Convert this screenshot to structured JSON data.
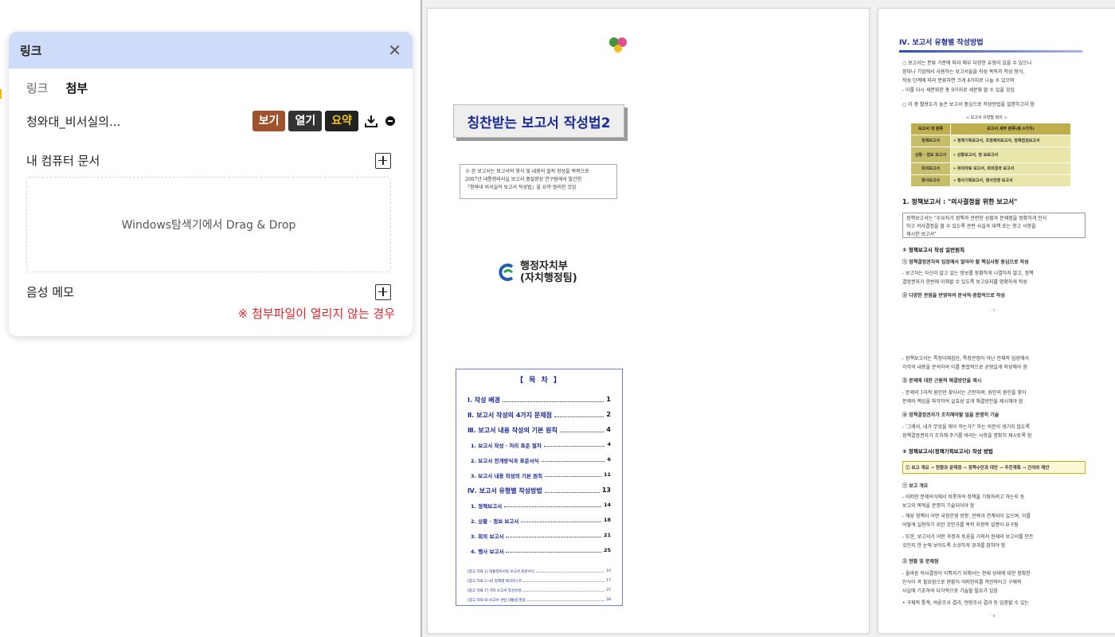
{
  "panel": {
    "title": "링크",
    "close_glyph": "✕",
    "tabs": [
      {
        "label": "링크",
        "active": false
      },
      {
        "label": "첨부",
        "active": true
      }
    ],
    "attachment": {
      "name": "청와대_비서실의...",
      "view_label": "보기",
      "open_label": "열기",
      "summary_label": "요약"
    },
    "my_docs_label": "내 컴퓨터 문서",
    "dropzone_text": "Windows탐색기에서 Drag & Drop",
    "voice_memo_label": "음성 메모",
    "warning_text": "※ 첨부파일이 열리지 않는 경우"
  },
  "document": {
    "page1": {
      "title": "칭찬받는 보고서 작성법2",
      "note_lines": [
        "※ 본 보고서는 보고서의 형식 및 내용의 질적 향상을 목적으로",
        "2007년 대통령비서실 보고서 품질향상 연구팀에서 발간한",
        "「청와대 비서실의 보고서 작성법」을 요약·정리한 것임"
      ],
      "ministry_line1": "행정자치부",
      "ministry_line2": "(자치행정팀)",
      "toc_title": "【 목  차 】",
      "toc": [
        {
          "label": "Ⅰ. 작성 배경",
          "page": "1",
          "level": 1
        },
        {
          "label": "Ⅱ. 보고서 작성의 4가지 문제점",
          "page": "2",
          "level": 1
        },
        {
          "label": "Ⅲ. 보고서 내용 작성의 기본 원칙",
          "page": "4",
          "level": 1
        },
        {
          "label": "1. 보고서 작성 · 처리 표준 절차",
          "page": "4",
          "level": 2
        },
        {
          "label": "2. 보고서 전개방식과 표준서식",
          "page": "6",
          "level": 2
        },
        {
          "label": "3. 보고서 내용 작성의 기본 원칙",
          "page": "11",
          "level": 2
        },
        {
          "label": "Ⅳ. 보고서 유형별 작성방법",
          "page": "13",
          "level": 1
        },
        {
          "label": "1. 정책보고서",
          "page": "14",
          "level": 2
        },
        {
          "label": "2. 상황 · 정보 보고서",
          "page": "18",
          "level": 2
        },
        {
          "label": "3. 회의 보고서",
          "page": "21",
          "level": 2
        },
        {
          "label": "4. 행사 보고서",
          "page": "25",
          "level": 2
        }
      ],
      "toc_refs": [
        {
          "label": "[참고 자료 1] 대통령비서실 보고서 표준서식",
          "page": "10"
        },
        {
          "label": "[참고 자료 2~6] 정책별 체크리스트",
          "page": "17"
        },
        {
          "label": "[참고 자료 7] 기타 보고서 작성유형",
          "page": "27"
        },
        {
          "label": "[참고 자료 8] 보고서 관련 대통령 말씀",
          "page": "28"
        }
      ]
    },
    "page2": {
      "heading": "Ⅳ. 보고서 유형별 작성방법",
      "intro_lines": [
        "○ 보고서는 분류 기준에 따라 매우 다양한 유형이 있을 수 있으나",
        "정부나 기업에서 사용하는 보고서들을 작성 목적과 작성 형식,",
        "작성 단계에 따라 분류하면 크게 4가지로 나눌 수 있으며",
        "- 이를 다시 세분화한 총 9가지로 세분화 할 수 있을 것임",
        "○ 이 중 활용도가 높은 보고서 중심으로 작성방법을 설명하고자 함"
      ],
      "table_title": "< 보고서 유형별 정의 >",
      "table_head": [
        "보고서 대 분류",
        "보고서 세부 분류(총 9가지)"
      ],
      "table_rows": [
        [
          "정책보고서",
          "• 정책기획보고서, 조정제의보고서, 정책점검보고서"
        ],
        [
          "상황 · 정보 보고서",
          "• 상황보고서, 정 보보고서"
        ],
        [
          "회의보고서",
          "• 회의자료 보고서, 회의결과 보고서"
        ],
        [
          "행사보고서",
          "• 행사기획보고서, 행사진행 보고서"
        ]
      ],
      "section1": "1. 정책보고서 : \"의사결정을 위한 보고서\"",
      "quote_lines": [
        "정책보고서는 \"수요자가 정책과 관련한 상황과 문제점을 정확하게 인식",
        "하고 의사결정을 할 수 있도록 관련 사실과 대책 또는 향고 사항을",
        "제시한 보고서\""
      ],
      "sub1": "① 정책보고서 작성 일반원칙",
      "p1_lines": [
        "① 정책결정권자의 입장에서 알아야 할 핵심사항 중심으로 작성",
        "- 보고자는 자신이 알고 있는 정보를 장황하게 나열하지 말고, 정책",
        "결정권자가 한번에 이해할 수 있도록 보고요지를 명확하게 작성",
        "② 다양한 관점을 반영하여 분석적·종합적으로 작성"
      ],
      "page_num_a": "- 3 -",
      "p2_lines": [
        "- 정책보고서는 특정이해집단, 특정관점이 아닌 전체적 입장에서",
        "각각의 내용을 분석하여 이를 종합적으로 균형있게 작성해야 함",
        "③ 문제에 대한 근원적 해결방안을 제시",
        "- 문제의 1차적 원인만 찾아서는 곤란하며, 원인의 원인을 찾아",
        "문제의 핵심을 파악하여 실효성 있게 해결방안을 제시해야 함",
        "④ 정책결정권자가 조치해야할 일을 분명히 기술",
        "- '그래서, 내가 무엇을 해야 하는가?' 하는 의문이 생기지 않도록",
        "정책결정권자가 조치해 주기를 바라는 사항을 명확히 제시토록 함"
      ],
      "sub2": "② 정책보고서(정책기획보고서) 작성 방법",
      "flow": "① 보고 개요 → 현황과 문제점 → 정책수단과 대안 → 추진계획 → 건의와 제안",
      "p3_lines": [
        "① 보고 개요",
        "- 어떠한 문제의식에서 비롯하여 정책을 기획하려고 하는지 등",
        "보고의 목적을 분명히 기술되어야 함",
        "- 해당 정책이 어떤 국정운영 방향, 전략과 연계되어 있으며, 이를",
        "어떻게 실현하기 위한 것인가를 목적 지향적 설명이 요구됨",
        "- 또한, 보고서가 어떤 과정과 토론을 거쳐서 현재의 보고서를 만든",
        "것인지 한 눈에 보이도록 소상하게 경과를 밝혀야 함",
        "② 현황 및 문제점",
        "- 올바른 의사결정이 이뤄지기 위해서는 현재 상태에 대한 정확한",
        "인식이 꼭 필요함으로 현황이 어떠한지를 객관적이고 구체적",
        "사실에 기초하여 다각적으로 기술할 필요가 있음",
        "• 구체적 통계, 여론조사 결과, 현장조사 결과 등 입증할 수 있는"
      ],
      "page_num_b": "- 4 -"
    }
  }
}
